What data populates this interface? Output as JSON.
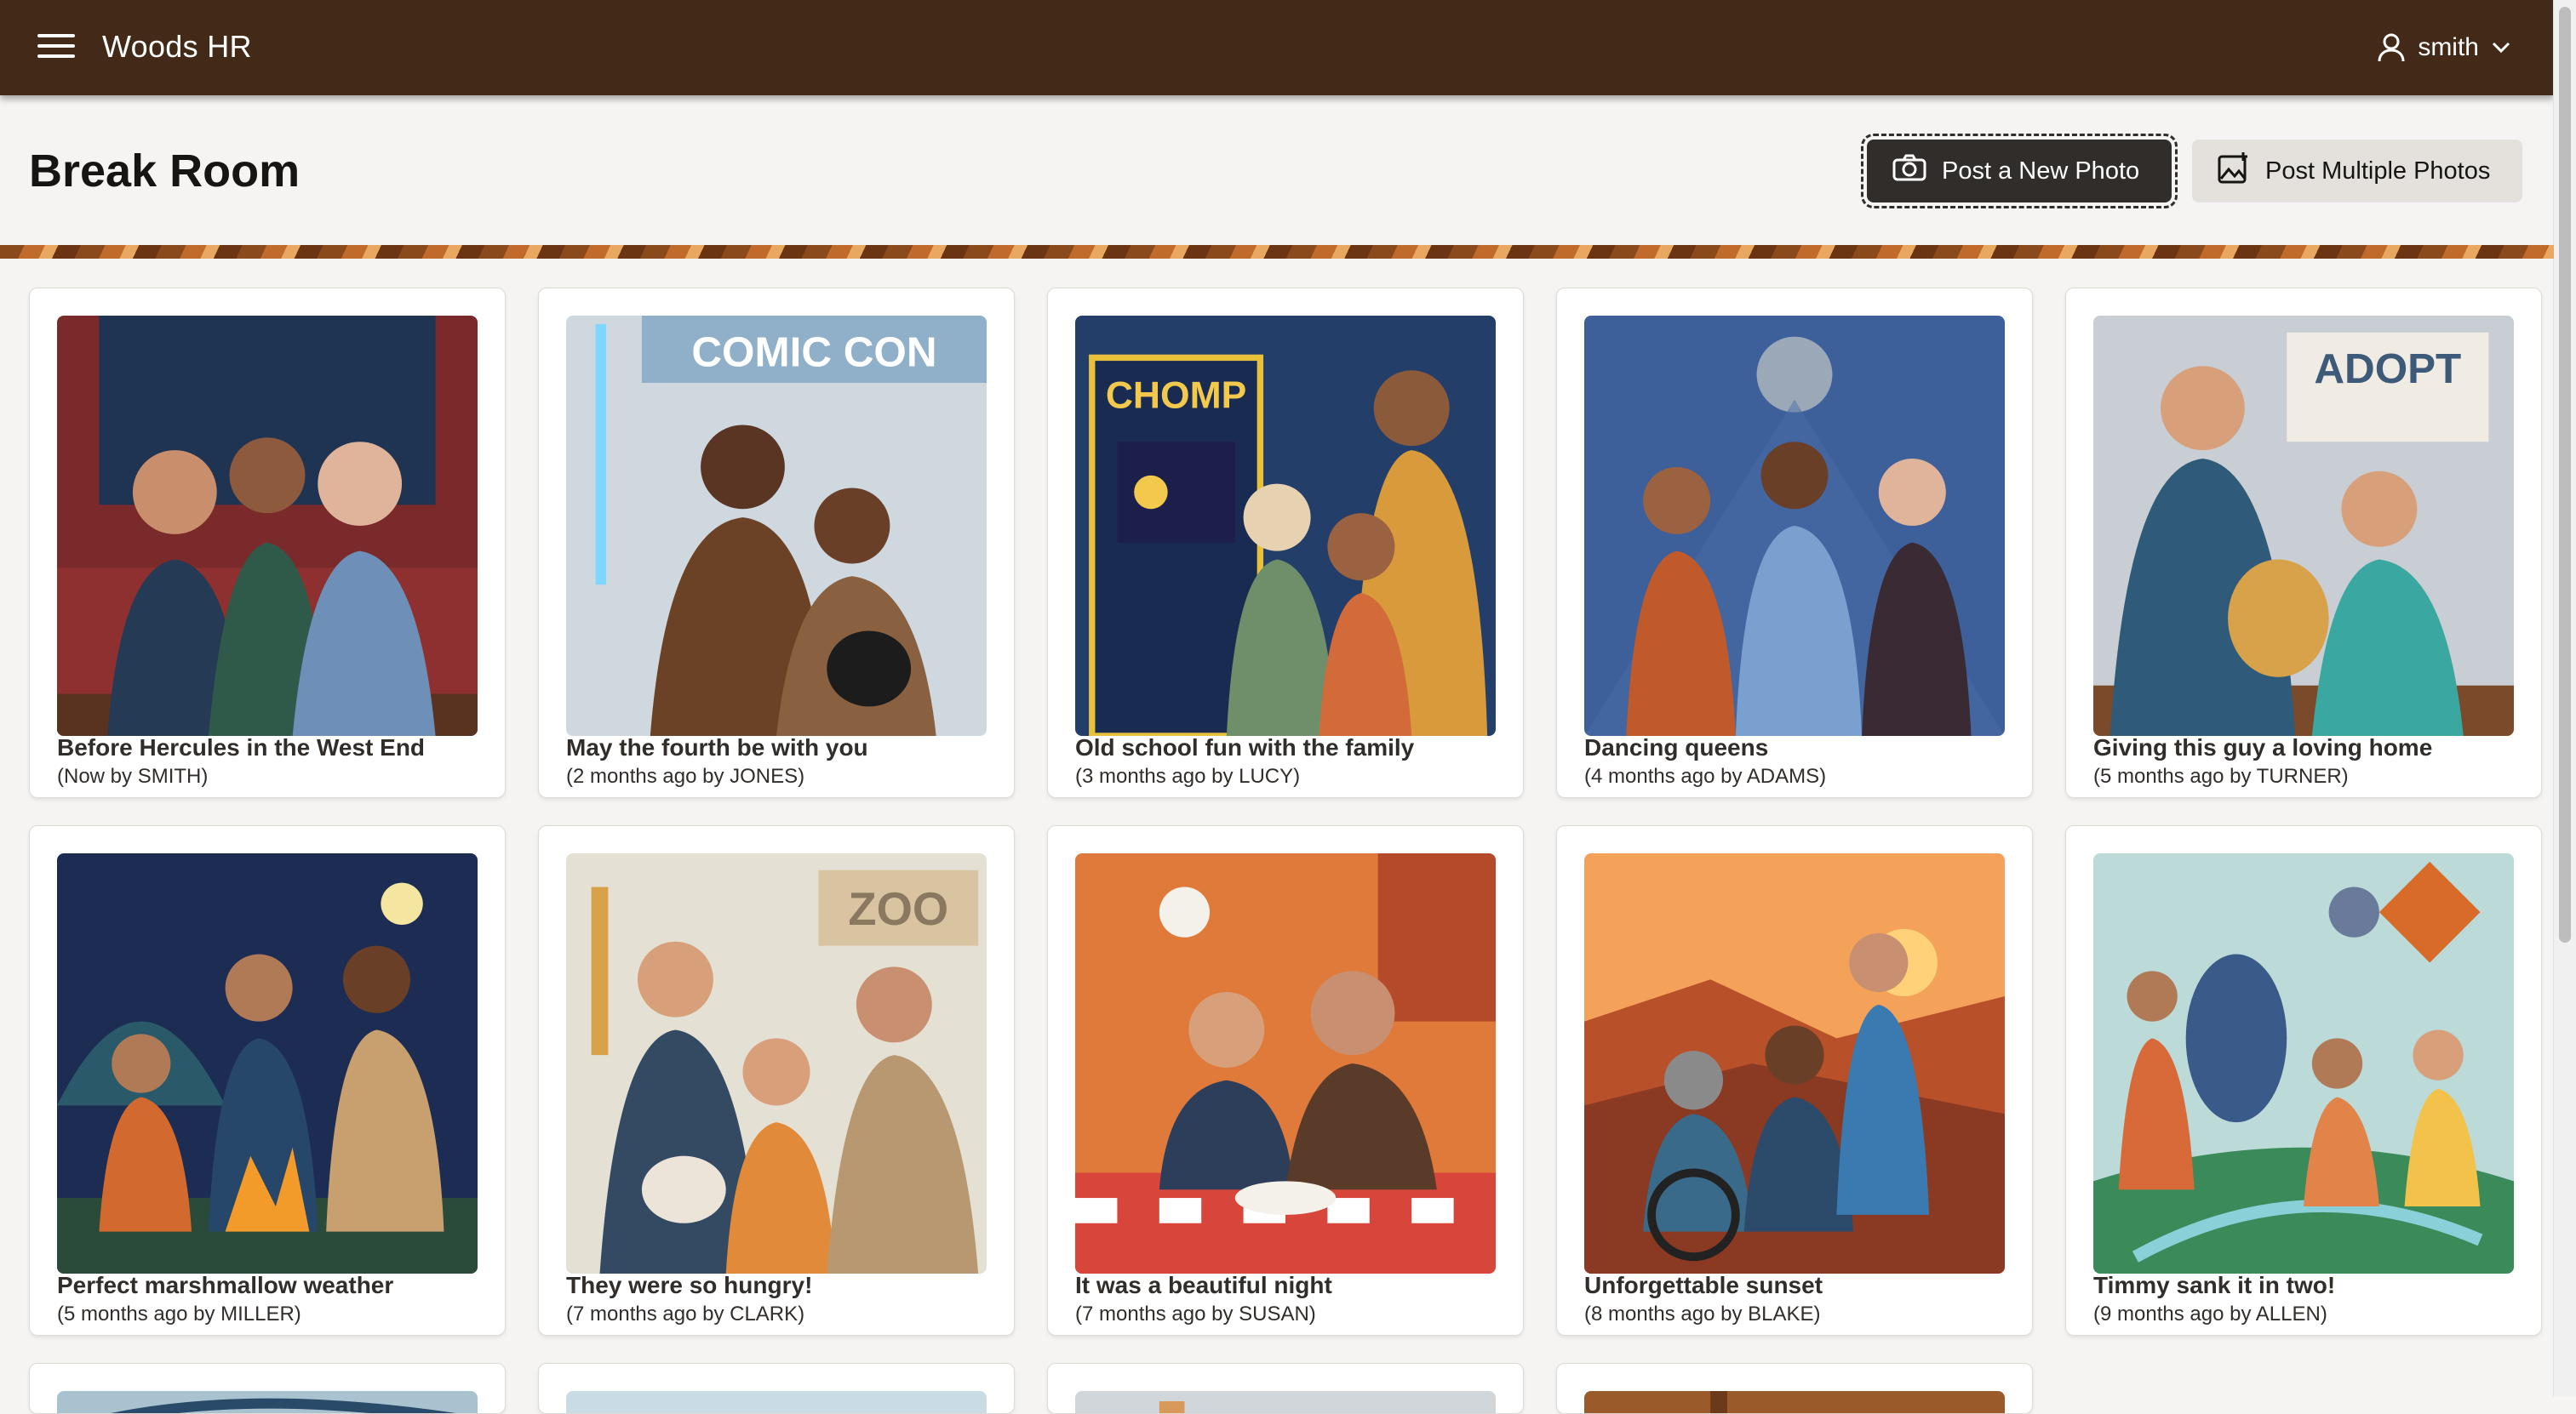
{
  "header": {
    "app_title": "Woods HR",
    "user_name": "smith"
  },
  "page": {
    "title": "Break Room",
    "post_photo_label": "Post a New Photo",
    "post_multiple_label": "Post Multiple Photos"
  },
  "photos": [
    {
      "title": "Before Hercules in the West End",
      "meta": "(Now by SMITH)"
    },
    {
      "title": "May the fourth be with you",
      "meta": "(2 months ago by JONES)",
      "banner": "COMIC CON"
    },
    {
      "title": "Old school fun with the family",
      "meta": "(3 months ago by LUCY)",
      "banner": "CHOMP"
    },
    {
      "title": "Dancing queens",
      "meta": "(4 months ago by ADAMS)"
    },
    {
      "title": "Giving this guy a loving home",
      "meta": "(5 months ago by TURNER)",
      "banner": "ADOPT"
    },
    {
      "title": "Perfect marshmallow weather",
      "meta": "(5 months ago by MILLER)"
    },
    {
      "title": "They were so hungry!",
      "meta": "(7 months ago by CLARK)",
      "banner": "ZOO"
    },
    {
      "title": "It was a beautiful night",
      "meta": "(7 months ago by SUSAN)"
    },
    {
      "title": "Unforgettable sunset",
      "meta": "(8 months ago by BLAKE)"
    },
    {
      "title": "Timmy sank it in two!",
      "meta": "(9 months ago by ALLEN)"
    }
  ]
}
